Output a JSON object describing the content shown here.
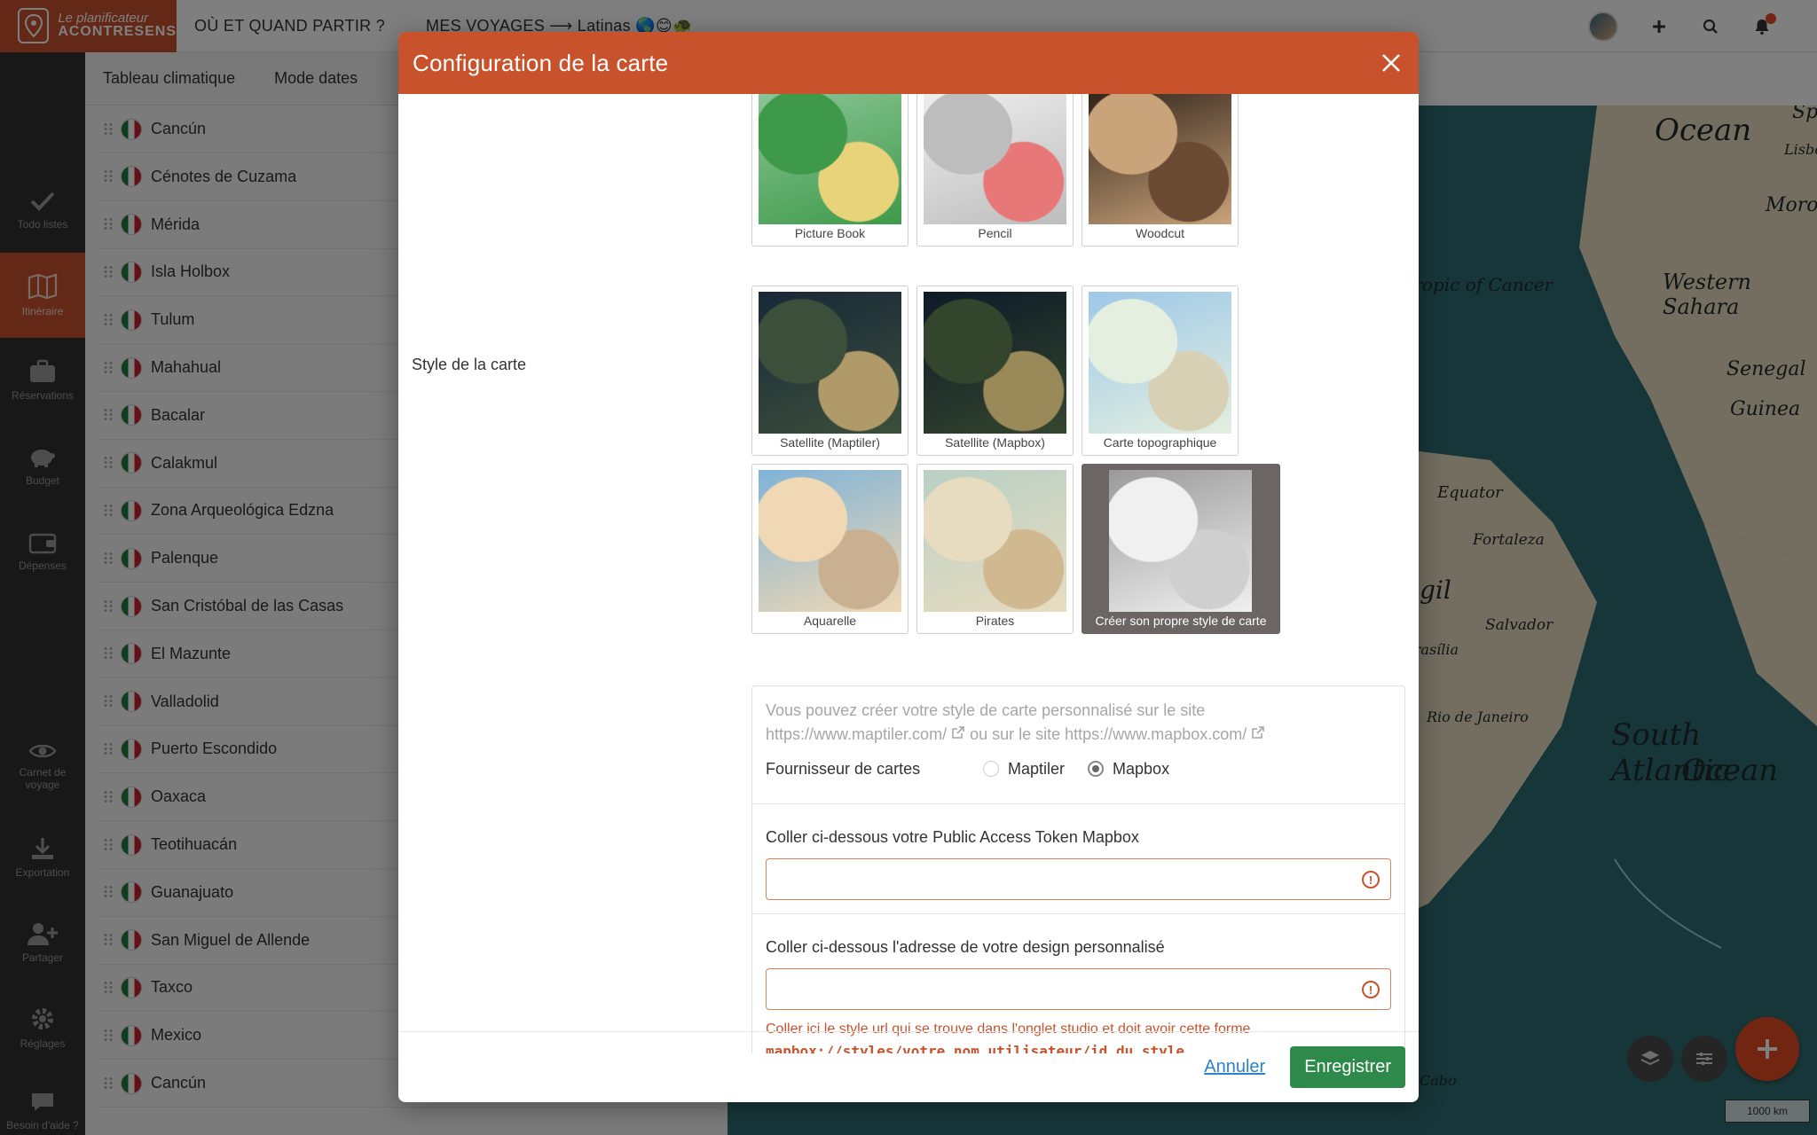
{
  "topbar": {
    "logo_line1": "Le planificateur",
    "logo_line2": "ACONTRESENS",
    "nav_where": "OÙ ET QUAND PARTIR ?",
    "nav_trips": "MES VOYAGES ⟶ Latinas 🌎😊🐢"
  },
  "sidebar": {
    "items": [
      {
        "label": "Todo listes",
        "icon": "check-icon"
      },
      {
        "label": "Itinéraire",
        "icon": "map-icon"
      },
      {
        "label": "Réservations",
        "icon": "suitcase-icon"
      },
      {
        "label": "Budget",
        "icon": "piggy-bank-icon"
      },
      {
        "label": "Dépenses",
        "icon": "wallet-icon"
      },
      {
        "label": "Carnet de voyage",
        "icon": "eye-icon"
      },
      {
        "label": "Exportation",
        "icon": "download-icon"
      },
      {
        "label": "Partager",
        "icon": "add-user-icon"
      },
      {
        "label": "Réglages",
        "icon": "gear-icon"
      },
      {
        "label": "Besoin d'aide ?",
        "icon": "chat-icon"
      }
    ]
  },
  "subnav": {
    "tab_climate": "Tableau climatique",
    "tab_dates": "Mode dates"
  },
  "destinations": [
    "Cancún",
    "Cénotes de Cuzama",
    "Mérida",
    "Isla Holbox",
    "Tulum",
    "Mahahual",
    "Bacalar",
    "Calakmul",
    "Zona Arqueológica Edzna",
    "Palenque",
    "San Cristóbal de las Casas",
    "El Mazunte",
    "Valladolid",
    "Puerto Escondido",
    "Oaxaca",
    "Teotihuacán",
    "Guanajuato",
    "San Miguel de Allende",
    "Taxco",
    "Mexico",
    "Cancún"
  ],
  "map": {
    "labels": [
      "Ocean",
      "Lisbon",
      "Moroc",
      "Tropic of Cancer",
      "Western Sahara",
      "Senegal",
      "Guinea",
      "Equator",
      "Fortaleza",
      "Salvador",
      "Brasília",
      "Rio de Janeiro",
      "South Atlantic",
      "Ocean",
      "Sp",
      "gil",
      "Cabo"
    ],
    "scale": "1000 km"
  },
  "modal": {
    "title": "Configuration de la carte",
    "style_label": "Style de la carte",
    "styles": [
      {
        "label": "Picture Book",
        "colors": [
          "#8fc79a",
          "#3e9a4a",
          "#e8d27a"
        ]
      },
      {
        "label": "Pencil",
        "colors": [
          "#f1f1f1",
          "#bdbdbd",
          "#e87878"
        ]
      },
      {
        "label": "Woodcut",
        "colors": [
          "#2a1d15",
          "#c9a37a",
          "#6b4a34"
        ]
      },
      {
        "label": "Satellite (Maptiler)",
        "colors": [
          "#182838",
          "#3c4f3a",
          "#b09a6a"
        ]
      },
      {
        "label": "Satellite (Mapbox)",
        "colors": [
          "#0e1a28",
          "#34452e",
          "#9a8a5a"
        ]
      },
      {
        "label": "Carte topographique",
        "colors": [
          "#9dc8e8",
          "#e4efe0",
          "#d8d0b4"
        ]
      },
      {
        "label": "Aquarelle",
        "colors": [
          "#7fb3d8",
          "#f0d8b4",
          "#c8b090"
        ]
      },
      {
        "label": "Pirates",
        "colors": [
          "#b8d0c4",
          "#e8dcc0",
          "#d0b890"
        ]
      },
      {
        "label": "Créer son propre style de carte",
        "colors": [
          "#9a9a9a",
          "#f0f0f0",
          "#cfcfcf"
        ]
      }
    ],
    "help_text_line1": "Vous pouvez créer votre style de carte personnalisé sur le site",
    "help_text_line2_a": "https://www.maptiler.com/",
    "help_text_line2_b": "ou sur le site https://www.mapbox.com/",
    "provider_label": "Fournisseur de cartes",
    "provider_options": [
      "Maptiler",
      "Mapbox"
    ],
    "provider_selected": "Mapbox",
    "token_label": "Coller ci-dessous votre Public Access Token Mapbox",
    "token_value": "",
    "design_label": "Coller ci-dessous l'adresse de votre design personnalisé",
    "design_value": "",
    "design_error": "Coller ici le style url qui se trouve dans l'onglet studio et doit avoir cette forme",
    "design_error_code": "mapbox://styles/votre_nom_utilisateur/id_du_style",
    "cancel_label": "Annuler",
    "save_label": "Enregistrer"
  },
  "colors": {
    "brand": "#c8522c",
    "save": "#2e8a4a",
    "link": "#2c84c4",
    "sidebar": "#303030"
  }
}
